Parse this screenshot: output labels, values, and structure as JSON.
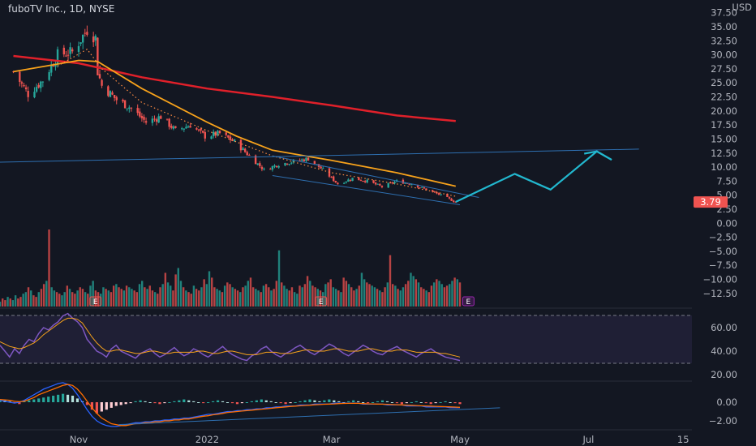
{
  "header": {
    "title": "fuboTV Inc., 1D, NYSE"
  },
  "currency": "USD",
  "price_badge": "3.79",
  "colors": {
    "background": "#131722",
    "up": "#26a69a",
    "down": "#ef5350",
    "ma_fast": "#f7a21b",
    "ma_slow": "#e0202a",
    "ma_dotted": "#ff8c42",
    "projection": "#22b8cf",
    "trendline": "#2e6fb0",
    "rsi": "#7e57c2",
    "rsi_signal": "#f7a21b",
    "macd": "#2962ff",
    "macd_signal": "#ff6d00",
    "badge": "#ef5350",
    "earnings": "#9c27b0"
  },
  "chart_data": {
    "type": "candlestick",
    "title": "fuboTV Inc., 1D, NYSE",
    "price_axis": {
      "unit": "USD",
      "ticks": [
        "37.50",
        "35.00",
        "32.50",
        "30.00",
        "27.50",
        "25.00",
        "22.50",
        "20.00",
        "17.50",
        "15.00",
        "12.50",
        "10.00",
        "7.50",
        "5.00",
        "2.50",
        "0.00",
        "−2.50",
        "−5.00",
        "−7.50",
        "−10.00",
        "−12.50"
      ],
      "last_price": 3.79
    },
    "x_axis": {
      "ticks": [
        "Nov",
        "2022",
        "Mar",
        "May",
        "Jul",
        "15"
      ]
    },
    "close_path": [
      [
        "2021-10-01",
        27.0
      ],
      [
        "2021-10-08",
        23.0
      ],
      [
        "2021-10-15",
        25.5
      ],
      [
        "2021-10-22",
        30.0
      ],
      [
        "2021-10-29",
        30.5
      ],
      [
        "2021-11-05",
        34.5
      ],
      [
        "2021-11-09",
        33.0
      ],
      [
        "2021-11-10",
        27.0
      ],
      [
        "2021-11-12",
        24.5
      ],
      [
        "2021-11-19",
        22.0
      ],
      [
        "2021-11-26",
        20.5
      ],
      [
        "2021-12-03",
        18.0
      ],
      [
        "2021-12-10",
        19.0
      ],
      [
        "2021-12-17",
        16.5
      ],
      [
        "2021-12-24",
        17.5
      ],
      [
        "2021-12-31",
        15.5
      ],
      [
        "2022-01-07",
        16.0
      ],
      [
        "2022-01-14",
        14.5
      ],
      [
        "2022-01-21",
        12.0
      ],
      [
        "2022-01-28",
        9.5
      ],
      [
        "2022-02-04",
        10.5
      ],
      [
        "2022-02-11",
        11.0
      ],
      [
        "2022-02-18",
        11.5
      ],
      [
        "2022-02-25",
        9.5
      ],
      [
        "2022-03-04",
        7.0
      ],
      [
        "2022-03-11",
        8.0
      ],
      [
        "2022-03-18",
        7.5
      ],
      [
        "2022-03-25",
        6.5
      ],
      [
        "2022-04-01",
        7.5
      ],
      [
        "2022-04-08",
        7.0
      ],
      [
        "2022-04-15",
        6.0
      ],
      [
        "2022-04-22",
        5.0
      ],
      [
        "2022-04-29",
        3.79
      ]
    ],
    "ma_slow_path": [
      [
        "2021-10-01",
        29.8
      ],
      [
        "2021-11-01",
        28.5
      ],
      [
        "2021-12-01",
        26.0
      ],
      [
        "2022-01-01",
        24.0
      ],
      [
        "2022-02-01",
        22.5
      ],
      [
        "2022-03-01",
        21.0
      ],
      [
        "2022-04-01",
        19.2
      ],
      [
        "2022-04-29",
        18.2
      ]
    ],
    "ma_fast_path": [
      [
        "2021-10-01",
        27.0
      ],
      [
        "2021-11-01",
        29.0
      ],
      [
        "2021-11-10",
        28.8
      ],
      [
        "2021-12-01",
        24.0
      ],
      [
        "2022-01-01",
        18.0
      ],
      [
        "2022-01-15",
        15.5
      ],
      [
        "2022-02-01",
        13.0
      ],
      [
        "2022-03-01",
        11.2
      ],
      [
        "2022-04-01",
        9.0
      ],
      [
        "2022-04-29",
        6.6
      ]
    ],
    "ma_dotted_path": [
      [
        "2021-10-22",
        28.0
      ],
      [
        "2021-11-05",
        31.0
      ],
      [
        "2021-11-12",
        27.5
      ],
      [
        "2021-12-01",
        21.5
      ],
      [
        "2022-01-01",
        16.5
      ],
      [
        "2022-02-01",
        12.0
      ],
      [
        "2022-03-01",
        9.0
      ],
      [
        "2022-04-01",
        7.0
      ],
      [
        "2022-04-29",
        4.8
      ]
    ],
    "trendlines": [
      {
        "name": "resistance",
        "from": [
          "2021-09-15",
          10.8
        ],
        "to": [
          "2022-07-25",
          13.2
        ]
      },
      {
        "name": "channel-upper",
        "from": [
          "2022-02-01",
          12.0
        ],
        "to": [
          "2022-05-10",
          4.6
        ]
      },
      {
        "name": "channel-lower",
        "from": [
          "2022-02-01",
          8.5
        ],
        "to": [
          "2022-05-01",
          3.3
        ]
      }
    ],
    "projection_path": [
      [
        "2022-04-29",
        3.8
      ],
      [
        "2022-05-27",
        8.8
      ],
      [
        "2022-06-13",
        6.0
      ],
      [
        "2022-07-05",
        12.8
      ],
      [
        "2022-07-12",
        11.3
      ]
    ],
    "projection_arrow": [
      [
        "2022-06-29",
        12.4
      ],
      [
        "2022-07-05",
        12.8
      ],
      [
        "2022-07-12",
        11.3
      ]
    ],
    "volume": [
      3,
      5,
      4,
      6,
      5,
      4,
      7,
      5,
      6,
      8,
      9,
      12,
      10,
      7,
      6,
      9,
      11,
      14,
      16,
      48,
      12,
      10,
      9,
      8,
      7,
      9,
      13,
      11,
      9,
      8,
      10,
      12,
      11,
      9,
      8,
      13,
      16,
      10,
      9,
      8,
      12,
      11,
      10,
      9,
      13,
      14,
      12,
      11,
      10,
      13,
      12,
      11,
      10,
      9,
      14,
      16,
      12,
      11,
      13,
      10,
      9,
      8,
      12,
      14,
      21,
      15,
      13,
      10,
      20,
      24,
      16,
      12,
      10,
      9,
      8,
      13,
      11,
      10,
      12,
      17,
      14,
      22,
      18,
      12,
      11,
      10,
      9,
      13,
      15,
      14,
      12,
      11,
      10,
      9,
      12,
      13,
      16,
      18,
      12,
      11,
      10,
      9,
      13,
      14,
      12,
      10,
      11,
      16,
      35,
      15,
      13,
      11,
      10,
      12,
      9,
      8,
      13,
      12,
      14,
      19,
      16,
      13,
      12,
      11,
      10,
      9,
      14,
      15,
      17,
      12,
      11,
      10,
      9,
      18,
      16,
      14,
      12,
      10,
      11,
      13,
      21,
      17,
      15,
      14,
      13,
      12,
      11,
      10,
      9,
      12,
      15,
      32,
      14,
      13,
      11,
      10,
      12,
      14,
      16,
      21,
      19,
      17,
      15,
      12,
      11,
      10,
      9,
      13,
      15,
      17,
      16,
      14,
      12,
      13,
      14,
      16,
      18,
      17,
      15
    ],
    "earnings_markers": [
      "2021-11-09",
      "2022-02-24",
      "2022-05-05"
    ],
    "earnings_label": "E",
    "rsi": {
      "ticks": [
        "60.00",
        "40.00",
        "20.00"
      ],
      "upper_band": 70,
      "lower_band": 30,
      "values": [
        45,
        40,
        35,
        42,
        38,
        45,
        50,
        48,
        55,
        60,
        58,
        62,
        65,
        70,
        72,
        68,
        65,
        60,
        50,
        45,
        40,
        38,
        35,
        42,
        45,
        40,
        38,
        36,
        34,
        38,
        40,
        42,
        38,
        35,
        37,
        40,
        43,
        39,
        36,
        38,
        42,
        40,
        37,
        35,
        38,
        41,
        44,
        40,
        37,
        35,
        33,
        32,
        36,
        38,
        42,
        44,
        40,
        37,
        35,
        38,
        40,
        43,
        45,
        42,
        39,
        37,
        40,
        43,
        46,
        44,
        41,
        38,
        36,
        39,
        42,
        45,
        43,
        40,
        38,
        37,
        40,
        42,
        44,
        41,
        39,
        37,
        35,
        38,
        40,
        42,
        39,
        37,
        35,
        34,
        33,
        32
      ],
      "signal": [
        48,
        46,
        44,
        43,
        42,
        43,
        45,
        47,
        50,
        54,
        57,
        60,
        63,
        66,
        68,
        68,
        67,
        64,
        58,
        52,
        47,
        43,
        40,
        40,
        41,
        41,
        40,
        39,
        38,
        38,
        39,
        40,
        40,
        39,
        38,
        38,
        39,
        39,
        39,
        39,
        39,
        40,
        40,
        39,
        38,
        38,
        39,
        40,
        40,
        39,
        38,
        37,
        37,
        37,
        38,
        39,
        39,
        39,
        38,
        38,
        38,
        39,
        40,
        41,
        41,
        40,
        40,
        40,
        41,
        42,
        42,
        41,
        40,
        40,
        40,
        41,
        42,
        42,
        41,
        40,
        40,
        40,
        41,
        41,
        41,
        40,
        39,
        39,
        39,
        39,
        39,
        38,
        38,
        37,
        36,
        35
      ]
    },
    "macd": {
      "ticks": [
        "0.00",
        "−2.00"
      ],
      "hist": [
        0.3,
        0.2,
        0.1,
        -0.1,
        -0.2,
        0.1,
        0.2,
        0.3,
        0.4,
        0.5,
        0.6,
        0.7,
        0.8,
        0.9,
        0.8,
        0.7,
        0.4,
        0.1,
        -0.3,
        -0.8,
        -1.2,
        -1.0,
        -0.8,
        -0.6,
        -0.4,
        -0.3,
        -0.2,
        -0.1,
        0.1,
        0.2,
        0.1,
        0.0,
        -0.1,
        -0.2,
        -0.1,
        0.0,
        0.1,
        0.2,
        0.3,
        0.2,
        0.1,
        0.0,
        -0.1,
        0.0,
        0.1,
        0.2,
        0.1,
        0.0,
        -0.1,
        -0.2,
        -0.1,
        0.0,
        0.1,
        0.2,
        0.3,
        0.2,
        0.1,
        0.0,
        -0.1,
        -0.2,
        -0.1,
        0.0,
        0.1,
        0.2,
        0.3,
        0.2,
        0.1,
        0.2,
        0.3,
        0.2,
        0.1,
        0.0,
        0.1,
        0.2,
        0.1,
        0.0,
        -0.1,
        0.0,
        0.1,
        0.2,
        0.1,
        0.0,
        -0.1,
        -0.2,
        -0.1,
        0.0,
        0.1,
        0.0,
        -0.1,
        -0.2,
        -0.1,
        0.0,
        0.1,
        0.0,
        -0.1,
        -0.2
      ],
      "macd_line": [
        0.2,
        0.1,
        0.0,
        -0.1,
        0.0,
        0.2,
        0.5,
        0.8,
        1.1,
        1.4,
        1.6,
        1.8,
        2.0,
        2.1,
        1.9,
        1.5,
        0.8,
        0.0,
        -0.8,
        -1.5,
        -2.0,
        -2.3,
        -2.5,
        -2.6,
        -2.6,
        -2.5,
        -2.4,
        -2.3,
        -2.2,
        -2.2,
        -2.1,
        -2.1,
        -2.0,
        -2.0,
        -1.9,
        -1.9,
        -1.8,
        -1.8,
        -1.7,
        -1.7,
        -1.6,
        -1.5,
        -1.4,
        -1.3,
        -1.3,
        -1.2,
        -1.1,
        -1.0,
        -1.0,
        -0.9,
        -0.9,
        -0.8,
        -0.8,
        -0.7,
        -0.7,
        -0.6,
        -0.6,
        -0.5,
        -0.5,
        -0.4,
        -0.4,
        -0.4,
        -0.3,
        -0.3,
        -0.3,
        -0.2,
        -0.2,
        -0.2,
        -0.2,
        -0.1,
        -0.1,
        -0.1,
        -0.1,
        -0.1,
        -0.1,
        -0.2,
        -0.2,
        -0.2,
        -0.2,
        -0.2,
        -0.3,
        -0.3,
        -0.3,
        -0.3,
        -0.4,
        -0.4,
        -0.4,
        -0.4,
        -0.5,
        -0.5,
        -0.5,
        -0.5,
        -0.5,
        -0.6,
        -0.6,
        -0.6
      ],
      "signal_line": [
        0.3,
        0.25,
        0.2,
        0.1,
        0.05,
        0.1,
        0.3,
        0.5,
        0.8,
        1.0,
        1.2,
        1.4,
        1.6,
        1.8,
        1.9,
        1.8,
        1.4,
        0.8,
        0.1,
        -0.6,
        -1.2,
        -1.7,
        -2.0,
        -2.3,
        -2.4,
        -2.5,
        -2.5,
        -2.4,
        -2.3,
        -2.3,
        -2.2,
        -2.2,
        -2.1,
        -2.1,
        -2.0,
        -2.0,
        -1.9,
        -1.9,
        -1.8,
        -1.8,
        -1.7,
        -1.6,
        -1.5,
        -1.45,
        -1.35,
        -1.3,
        -1.2,
        -1.1,
        -1.05,
        -1.0,
        -0.95,
        -0.9,
        -0.85,
        -0.8,
        -0.75,
        -0.7,
        -0.65,
        -0.6,
        -0.55,
        -0.5,
        -0.45,
        -0.42,
        -0.38,
        -0.35,
        -0.32,
        -0.28,
        -0.25,
        -0.22,
        -0.2,
        -0.18,
        -0.15,
        -0.13,
        -0.12,
        -0.12,
        -0.12,
        -0.15,
        -0.17,
        -0.18,
        -0.2,
        -0.21,
        -0.23,
        -0.25,
        -0.27,
        -0.29,
        -0.31,
        -0.33,
        -0.36,
        -0.38,
        -0.4,
        -0.42,
        -0.44,
        -0.46,
        -0.48,
        -0.5,
        -0.52,
        -0.55
      ],
      "trendline": {
        "from": [
          "2021-11-20",
          -2.4
        ],
        "to": [
          "2022-05-20",
          -0.6
        ]
      }
    }
  }
}
